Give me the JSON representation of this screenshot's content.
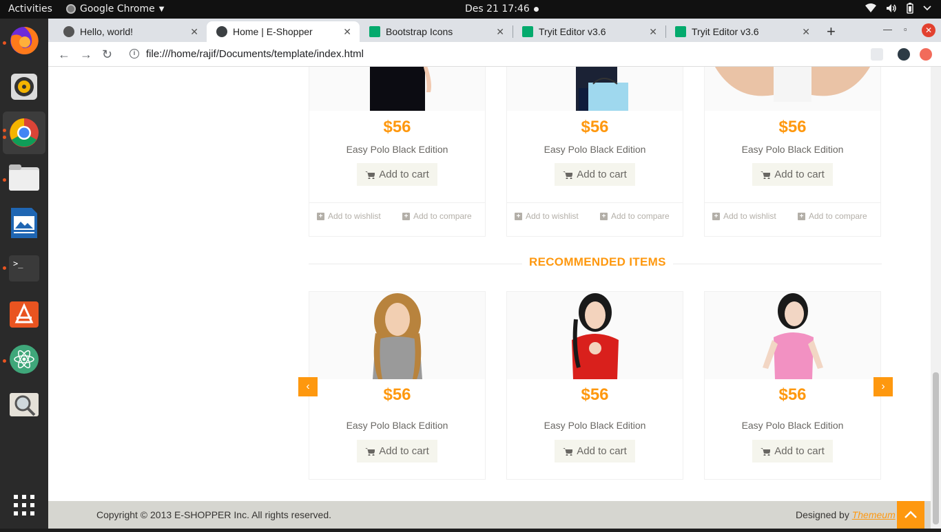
{
  "system": {
    "activities": "Activities",
    "app_name": "Google Chrome",
    "clock": "Des 21  17:46"
  },
  "browser": {
    "tabs": [
      {
        "title": "Hello, world!"
      },
      {
        "title": "Home | E-Shopper"
      },
      {
        "title": "Bootstrap Icons"
      },
      {
        "title": "Tryit Editor v3.6"
      },
      {
        "title": "Tryit Editor v3.6"
      }
    ],
    "url": "file:///home/rajif/Documents/template/index.html"
  },
  "top_products": [
    {
      "price": "$56",
      "name": "Easy Polo Black Edition",
      "cart": "Add to cart",
      "wishlist": "Add to wishlist",
      "compare": "Add to compare"
    },
    {
      "price": "$56",
      "name": "Easy Polo Black Edition",
      "cart": "Add to cart",
      "wishlist": "Add to wishlist",
      "compare": "Add to compare"
    },
    {
      "price": "$56",
      "name": "Easy Polo Black Edition",
      "cart": "Add to cart",
      "wishlist": "Add to wishlist",
      "compare": "Add to compare"
    }
  ],
  "recommended": {
    "title": "RECOMMENDED ITEMS",
    "items": [
      {
        "price": "$56",
        "name": "Easy Polo Black Edition",
        "cart": "Add to cart"
      },
      {
        "price": "$56",
        "name": "Easy Polo Black Edition",
        "cart": "Add to cart"
      },
      {
        "price": "$56",
        "name": "Easy Polo Black Edition",
        "cart": "Add to cart"
      }
    ]
  },
  "footer": {
    "copyright": "Copyright © 2013 E-SHOPPER Inc. All rights reserved.",
    "designed_prefix": "Designed by ",
    "designer": "Themeum"
  },
  "colors": {
    "accent": "#fe980f",
    "footer_bg": "#d6d6d0"
  }
}
